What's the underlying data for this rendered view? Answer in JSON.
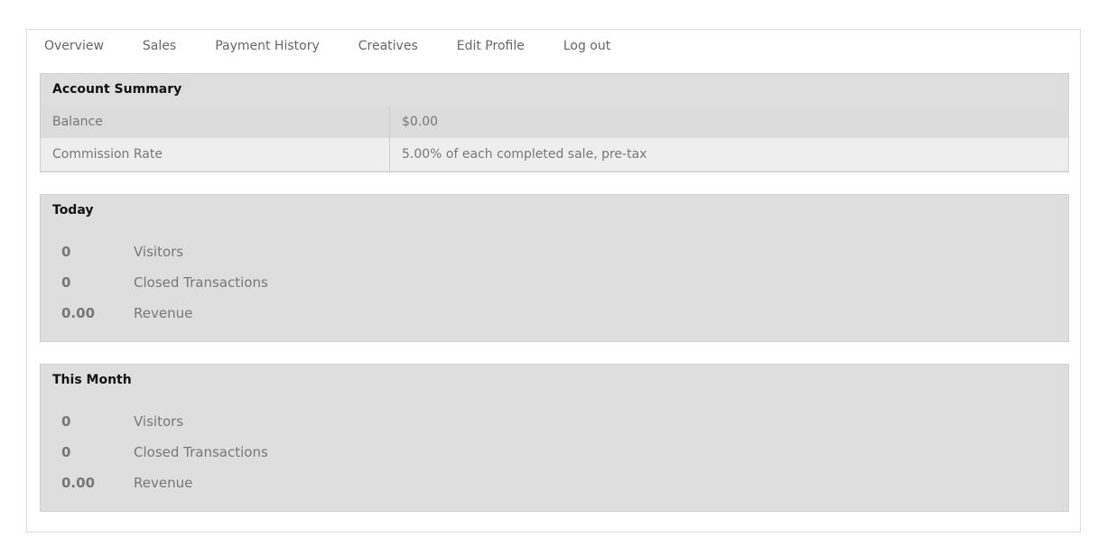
{
  "nav": {
    "items": [
      {
        "label": "Overview"
      },
      {
        "label": "Sales"
      },
      {
        "label": "Payment History"
      },
      {
        "label": "Creatives"
      },
      {
        "label": "Edit Profile"
      },
      {
        "label": "Log out"
      }
    ]
  },
  "account_summary": {
    "title": "Account Summary",
    "rows": [
      {
        "label": "Balance",
        "value": "$0.00"
      },
      {
        "label": "Commission Rate",
        "value": "5.00% of each completed sale, pre-tax"
      }
    ]
  },
  "today": {
    "title": "Today",
    "stats": [
      {
        "value": "0",
        "label": "Visitors"
      },
      {
        "value": "0",
        "label": "Closed Transactions"
      },
      {
        "value": "0.00",
        "label": "Revenue"
      }
    ]
  },
  "this_month": {
    "title": "This Month",
    "stats": [
      {
        "value": "0",
        "label": "Visitors"
      },
      {
        "value": "0",
        "label": "Closed Transactions"
      },
      {
        "value": "0.00",
        "label": "Revenue"
      }
    ]
  },
  "colors": {
    "panel_bg": "#dedede",
    "row_alt_bg": "#eeeeee",
    "text_muted": "#777777",
    "title_text": "#111111"
  }
}
